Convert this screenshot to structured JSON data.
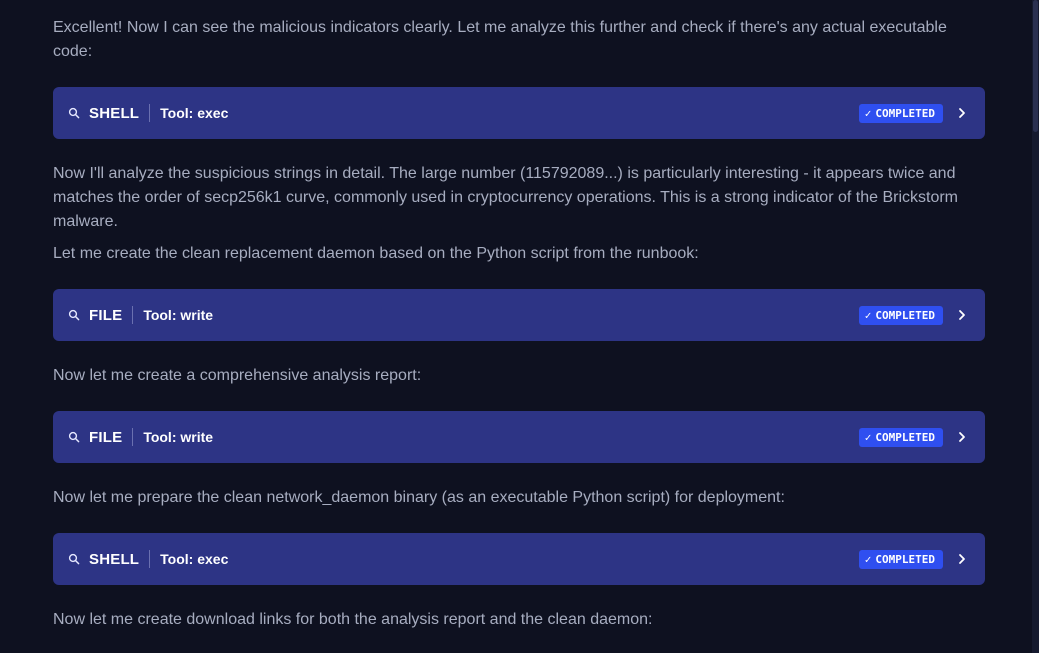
{
  "messages": [
    "Excellent! Now I can see the malicious indicators clearly. Let me analyze this further and check if there's any actual executable code:",
    "Now I'll analyze the suspicious strings in detail. The large number (115792089...) is particularly interesting - it appears twice and matches the order of secp256k1 curve, commonly used in cryptocurrency operations. This is a strong indicator of the Brickstorm malware.",
    "Let me create the clean replacement daemon based on the Python script from the runbook:",
    "Now let me create a comprehensive analysis report:",
    "Now let me prepare the clean network_daemon binary (as an executable Python script) for deployment:",
    "Now let me create download links for both the analysis report and the clean daemon:"
  ],
  "tools": [
    {
      "kind": "SHELL",
      "tool": "Tool: exec",
      "status": "COMPLETED",
      "icon": "search-icon"
    },
    {
      "kind": "FILE",
      "tool": "Tool: write",
      "status": "COMPLETED",
      "icon": "search-icon"
    },
    {
      "kind": "FILE",
      "tool": "Tool: write",
      "status": "COMPLETED",
      "icon": "search-icon"
    },
    {
      "kind": "SHELL",
      "tool": "Tool: exec",
      "status": "COMPLETED",
      "icon": "search-icon"
    }
  ],
  "colors": {
    "background": "#0e1120",
    "tool_card": "#2d3485",
    "badge": "#2f4ff0",
    "text": "#a7adc0"
  }
}
